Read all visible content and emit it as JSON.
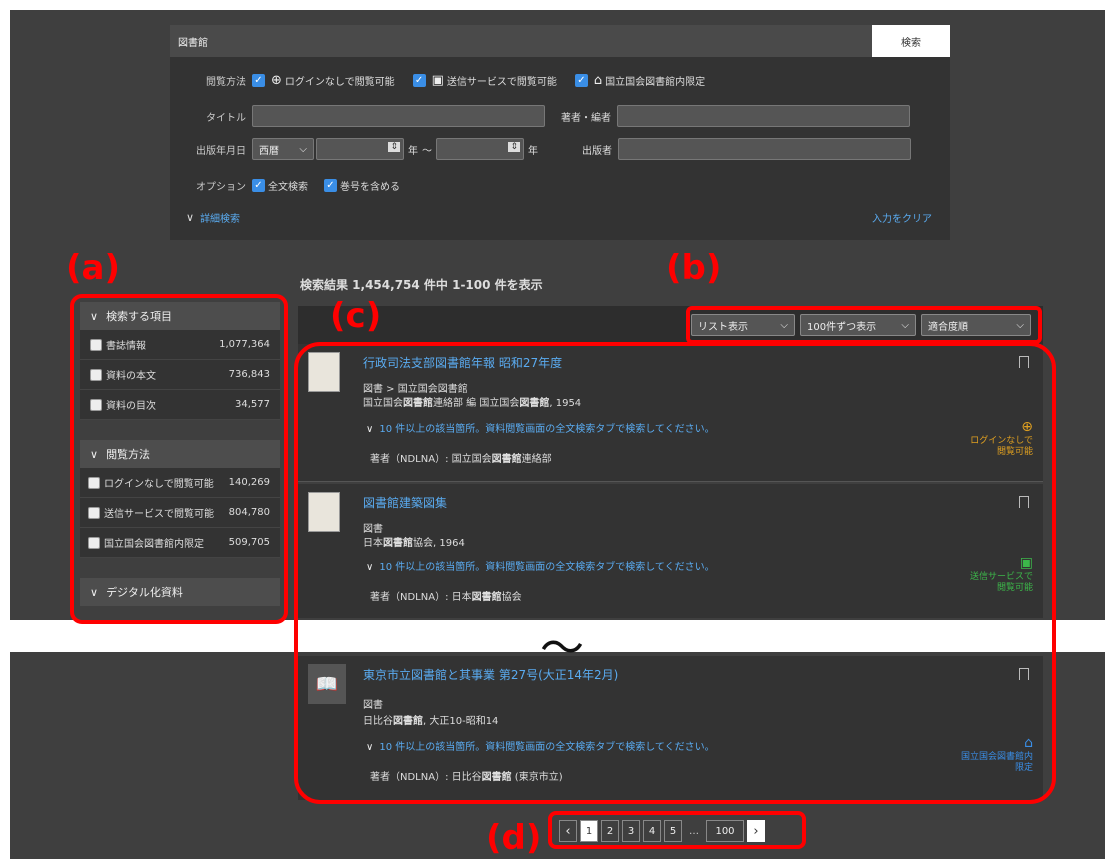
{
  "search": {
    "keyword": "図書館",
    "search_button": "検索",
    "access_label": "閲覧方法",
    "access_options": [
      "ログインなしで閲覧可能",
      "送信サービスで閲覧可能",
      "国立国会図書館内限定"
    ],
    "title_label": "タイトル",
    "author_label": "著者・編者",
    "pubdate_label": "出版年月日",
    "era_select": "西暦",
    "year_unit": "年",
    "range_sep": "～",
    "publisher_label": "出版者",
    "option_label": "オプション",
    "options": [
      "全文検索",
      "巻号を含める"
    ],
    "advanced_link": "詳細検索",
    "clear_link": "入力をクリア"
  },
  "result_count": "検索結果 1,454,754 件中 1-100 件を表示",
  "facets": [
    {
      "heading": "検索する項目",
      "items": [
        {
          "label": "書誌情報",
          "count": "1,077,364"
        },
        {
          "label": "資料の本文",
          "count": "736,843"
        },
        {
          "label": "資料の目次",
          "count": "34,577"
        }
      ]
    },
    {
      "heading": "閲覧方法",
      "items": [
        {
          "label": "ログインなしで閲覧可能",
          "count": "140,269"
        },
        {
          "label": "送信サービスで閲覧可能",
          "count": "804,780"
        },
        {
          "label": "国立国会図書館内限定",
          "count": "509,705"
        }
      ]
    },
    {
      "heading": "デジタル化資料",
      "items": []
    }
  ],
  "toolbar": {
    "view": "リスト表示",
    "per_page": "100件ずつ表示",
    "sort": "適合度順"
  },
  "results": [
    {
      "title": "行政司法支部図書館年報 昭和27年度",
      "type": "図書 > 国立国会図書館",
      "pub_pre": "国立国会",
      "pub_bold": "図書館",
      "pub_mid": "連絡部 編 国立国会",
      "pub_bold2": "図書館",
      "pub_post": ", 1954",
      "hits": "10 件以上の該当箇所。資料閲覧画面の全文検索タブで検索してください。",
      "author_pre": "著者（NDLNA）: 国立国会",
      "author_bold": "図書館",
      "author_post": "連絡部",
      "access_line1": "ログインなしで",
      "access_line2": "閲覧可能",
      "access_color": "#e0a020"
    },
    {
      "title": "図書館建築図集",
      "type": "図書",
      "pub_pre": "日本",
      "pub_bold": "図書館",
      "pub_mid": "協会, 1964",
      "pub_bold2": "",
      "pub_post": "",
      "hits": "10 件以上の該当箇所。資料閲覧画面の全文検索タブで検索してください。",
      "author_pre": "著者（NDLNA）: 日本",
      "author_bold": "図書館",
      "author_post": "協会",
      "access_line1": "送信サービスで",
      "access_line2": "閲覧可能",
      "access_color": "#3cb84a"
    },
    {
      "title": "東京市立図書館と其事業 第27号(大正14年2月)",
      "type": "図書",
      "pub_pre": "日比谷",
      "pub_bold": "図書館",
      "pub_mid": ", 大正10-昭和14",
      "pub_bold2": "",
      "pub_post": "",
      "hits": "10 件以上の該当箇所。資料閲覧画面の全文検索タブで検索してください。",
      "author_pre": "著者（NDLNA）: 日比谷",
      "author_bold": "図書館",
      "author_post": " (東京市立)",
      "access_line1": "国立国会図書館内",
      "access_line2": "限定",
      "access_color": "#3a8ee6"
    }
  ],
  "pagination": {
    "pages": [
      "1",
      "2",
      "3",
      "4",
      "5"
    ],
    "ellipsis": "…",
    "last": "100"
  },
  "annotations": {
    "a": "(a)",
    "b": "(b)",
    "c": "(c)",
    "d": "(d)",
    "tilde": "〜"
  },
  "colors": {
    "accent": "#3a8ee6",
    "link": "#5aabf0",
    "annotation": "#ff0000"
  }
}
